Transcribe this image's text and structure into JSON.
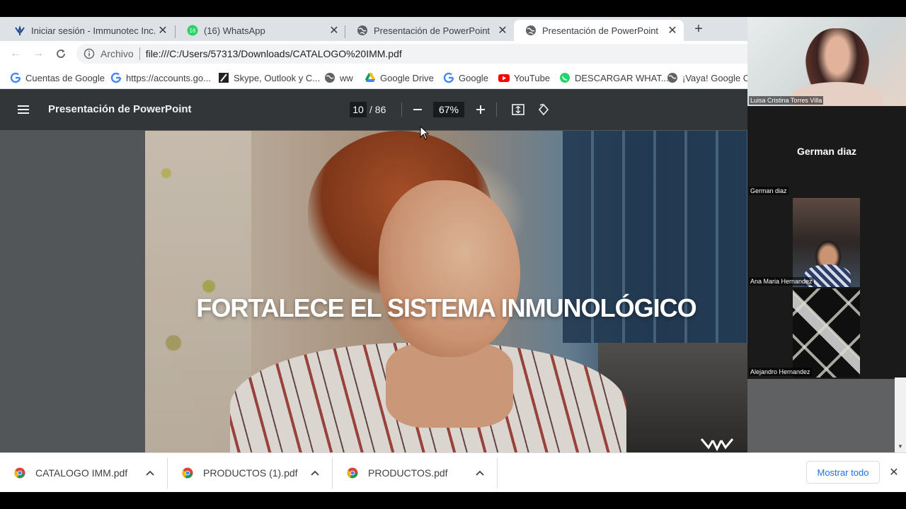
{
  "tabs": [
    {
      "label": "Iniciar sesión - Immunotec Inc.",
      "icon": "immunotec-icon",
      "active": false
    },
    {
      "label": "(16) WhatsApp",
      "icon": "whatsapp-icon",
      "active": false
    },
    {
      "label": "Presentación de PowerPoint",
      "icon": "globe-icon",
      "active": false
    },
    {
      "label": "Presentación de PowerPoint",
      "icon": "globe-icon",
      "active": true
    }
  ],
  "whatsapp_badge": "16",
  "address": {
    "scheme_label": "Archivo",
    "url": "file:///C:/Users/57313/Downloads/CATALOGO%20IMM.pdf"
  },
  "bookmarks": [
    {
      "label": "Cuentas de Google",
      "icon": "google-icon"
    },
    {
      "label": "https://accounts.go...",
      "icon": "google-icon"
    },
    {
      "label": "Skype, Outlook y C...",
      "icon": "skype-icon"
    },
    {
      "label": "ww",
      "icon": "globe-icon"
    },
    {
      "label": "Google Drive",
      "icon": "drive-icon"
    },
    {
      "label": "Google",
      "icon": "google-icon"
    },
    {
      "label": "YouTube",
      "icon": "youtube-icon"
    },
    {
      "label": "DESCARGAR WHAT...",
      "icon": "whatsapp-icon"
    },
    {
      "label": "¡Vaya! Google Ch",
      "icon": "globe-icon"
    }
  ],
  "pdf": {
    "title": "Presentación de PowerPoint",
    "current_page": "10",
    "total_pages": "/  86",
    "zoom": "67%",
    "slide_title": "FORTALECE EL SISTEMA INMUNOLÓGICO"
  },
  "participants": [
    {
      "name": "Luisa Cristina Torres Villa"
    },
    {
      "name": "German diaz",
      "display_name": "German diaz"
    },
    {
      "name": "Ana Maria Hernandez"
    },
    {
      "name": "Alejandro Hernandez"
    }
  ],
  "downloads": [
    {
      "name": "CATALOGO IMM.pdf"
    },
    {
      "name": "PRODUCTOS (1).pdf"
    },
    {
      "name": "PRODUCTOS.pdf"
    }
  ],
  "downloads_bar": {
    "show_all": "Mostrar todo"
  },
  "colors": {
    "accent": "#1a73e8",
    "pdf_toolbar": "#323639",
    "pdf_bg": "#525659",
    "tabstrip": "#dee1e6"
  }
}
